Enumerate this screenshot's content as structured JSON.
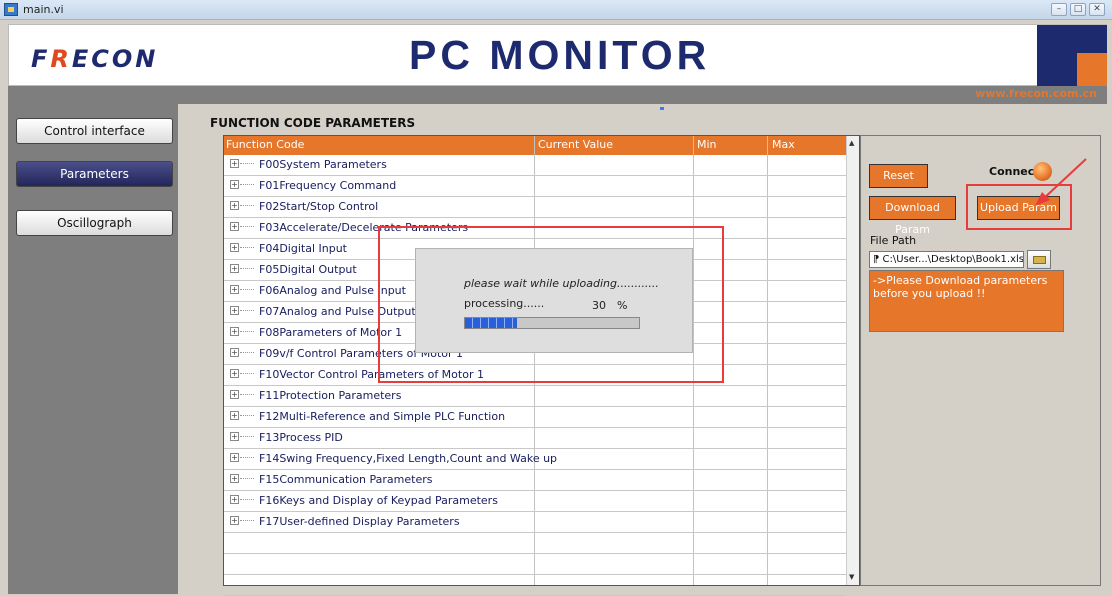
{
  "window": {
    "title": "main.vi",
    "minimize": "–",
    "maximize": "□",
    "close": "✕"
  },
  "header": {
    "logo_pre": "F",
    "logo_r": "R",
    "logo_post": "ECON",
    "title": "PC MONITOR",
    "url": "www.frecon.com.cn"
  },
  "nav": {
    "items": [
      {
        "label": "Control interface",
        "active": false
      },
      {
        "label": "Parameters",
        "active": true
      },
      {
        "label": "Oscillograph",
        "active": false
      }
    ]
  },
  "main": {
    "section_title": "FUNCTION CODE PARAMETERS",
    "columns": [
      "Function Code",
      "Current Value",
      "Min",
      "Max"
    ],
    "rows": [
      "F00System Parameters",
      "F01Frequency Command",
      "F02Start/Stop Control",
      "F03Accelerate/Decelerate Parameters",
      "F04Digital Input",
      "F05Digital Output",
      "F06Analog and Pulse Input",
      "F07Analog and Pulse Output",
      "F08Parameters of Motor 1",
      "F09v/f Control Parameters of Motor 1",
      "F10Vector Control Parameters of Motor 1",
      "F11Protection Parameters",
      "F12Multi-Reference and Simple PLC Function",
      "F13Process PID",
      "F14Swing Frequency,Fixed Length,Count and Wake up",
      "F15Communication Parameters",
      "F16Keys and Display of Keypad Parameters",
      "F17User-defined Display Parameters"
    ]
  },
  "controls": {
    "reset": "Reset",
    "connect": "Connect",
    "download": "Download Param",
    "upload": "Upload Param",
    "file_path_label": "File Path",
    "file_path": "C:\\User...\\Desktop\\Book1.xls",
    "message": "->Please Download parameters before you upload !!"
  },
  "dialog": {
    "wait": "please wait while uploading............",
    "processing": "processing......",
    "percent": "30",
    "percent_sign": "%",
    "progress": 0.3
  },
  "colors": {
    "brand_navy": "#1e2a6e",
    "accent_orange": "#e6762a",
    "highlight_red": "#e83b3b"
  }
}
